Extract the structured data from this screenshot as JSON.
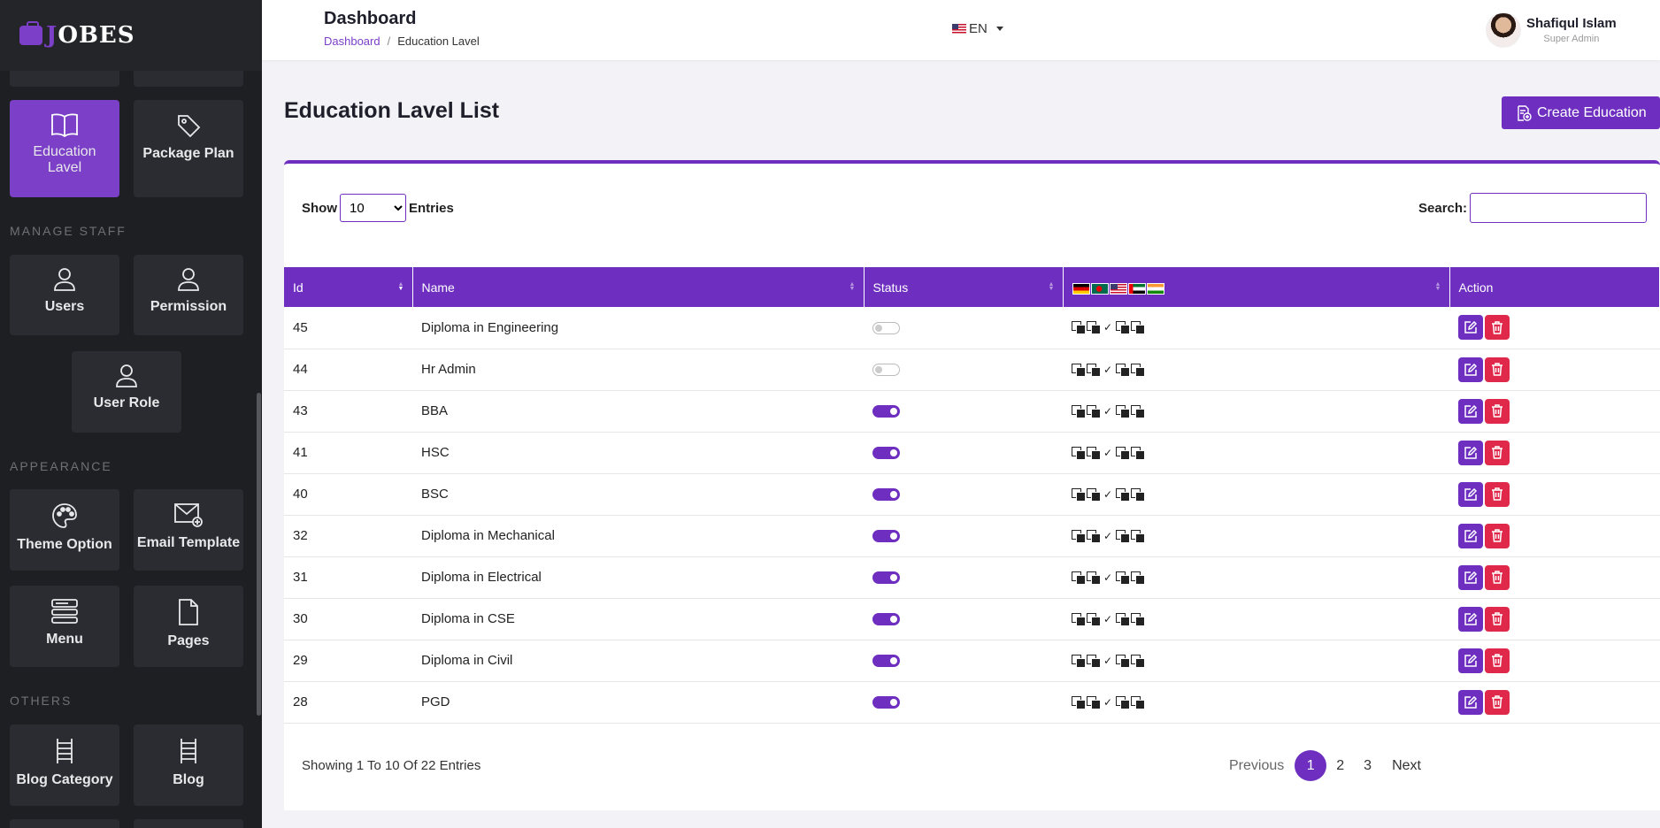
{
  "brand": {
    "logo_text": "OBES",
    "logo_initial": "J"
  },
  "sidebar": {
    "sections": [
      {
        "label": "MANAGE STAFF"
      },
      {
        "label": "APPEARANCE"
      },
      {
        "label": "OTHERS"
      }
    ],
    "tiles": [
      {
        "label": "Education Lavel",
        "icon": "book-icon",
        "active": true
      },
      {
        "label": "Package Plan",
        "icon": "tag-icon"
      },
      {
        "label": "Users",
        "icon": "user-icon"
      },
      {
        "label": "Permission",
        "icon": "user-icon"
      },
      {
        "label": "User Role",
        "icon": "user-icon"
      },
      {
        "label": "Theme Option",
        "icon": "palette-icon"
      },
      {
        "label": "Email Template",
        "icon": "mail-plus-icon"
      },
      {
        "label": "Menu",
        "icon": "menu-stack-icon"
      },
      {
        "label": "Pages",
        "icon": "file-icon"
      },
      {
        "label": "Blog Category",
        "icon": "ladder-icon"
      },
      {
        "label": "Blog",
        "icon": "ladder-icon"
      }
    ]
  },
  "header": {
    "title": "Dashboard",
    "breadcrumb": {
      "home": "Dashboard",
      "separator": "/",
      "current": "Education Lavel"
    },
    "language": "EN",
    "user": {
      "name": "Shafiqul Islam",
      "role": "Super Admin"
    }
  },
  "main": {
    "title": "Education Lavel List",
    "create_button": "Create Education",
    "show_label": "Show",
    "entries_label": "Entries",
    "page_size": "10",
    "search_label": "Search:",
    "search_value": "",
    "columns": [
      "Id",
      "Name",
      "Status",
      "",
      "Action"
    ],
    "rows": [
      {
        "id": "45",
        "name": "Diploma in Engineering",
        "status": false
      },
      {
        "id": "44",
        "name": "Hr Admin",
        "status": false
      },
      {
        "id": "43",
        "name": "BBA",
        "status": true
      },
      {
        "id": "41",
        "name": "HSC",
        "status": true
      },
      {
        "id": "40",
        "name": "BSC",
        "status": true
      },
      {
        "id": "32",
        "name": "Diploma in Mechanical",
        "status": true
      },
      {
        "id": "31",
        "name": "Diploma in Electrical",
        "status": true
      },
      {
        "id": "30",
        "name": "Diploma in CSE",
        "status": true
      },
      {
        "id": "29",
        "name": "Diploma in Civil",
        "status": true
      },
      {
        "id": "28",
        "name": "PGD",
        "status": true
      }
    ],
    "footer_text": "Showing 1 To 10 Of 22 Entries",
    "pagination": {
      "prev": "Previous",
      "pages": [
        "1",
        "2",
        "3"
      ],
      "current": "1",
      "next": "Next"
    }
  },
  "colors": {
    "accent": "#6e2fc0",
    "danger": "#e0294a",
    "sidebar_bg": "#1e1f22"
  }
}
